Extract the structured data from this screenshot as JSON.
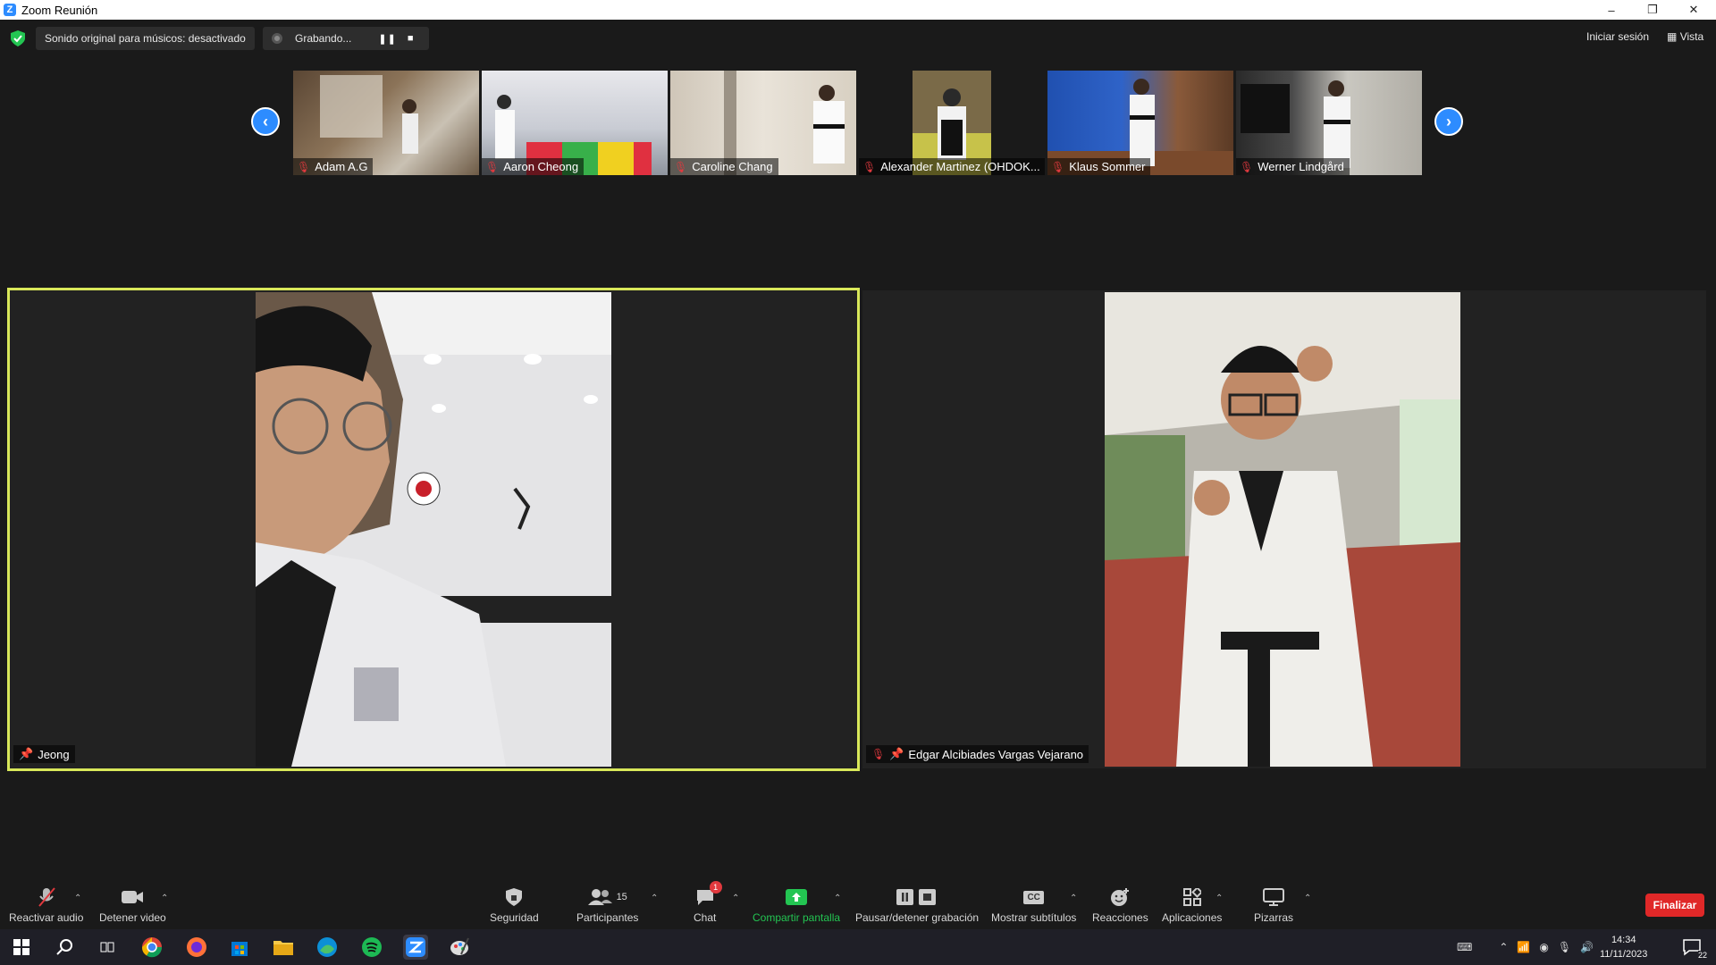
{
  "window": {
    "title": "Zoom Reunión",
    "logo_letter": "Z",
    "controls": {
      "minimize": "–",
      "restore": "❐",
      "close": "✕"
    }
  },
  "topbar": {
    "audio_status": "Sonido original para músicos: desactivado",
    "recording_label": "Grabando...",
    "pause_symbol": "❚❚",
    "stop_symbol": "■",
    "sign_in": "Iniciar sesión",
    "view": "Vista",
    "view_icon": "▦"
  },
  "gallery_strip": {
    "prev_symbol": "‹",
    "next_symbol": "›",
    "thumbnails": [
      {
        "name": "Adam A.G"
      },
      {
        "name": "Aaron Cheong"
      },
      {
        "name": "Caroline Chang"
      },
      {
        "name": "Alexander Martinez (OHDOK..."
      },
      {
        "name": "Klaus Sommer"
      },
      {
        "name": "Werner Lindgård"
      }
    ]
  },
  "main_videos": [
    {
      "name": "Jeong",
      "active_speaker": true
    },
    {
      "name": "Edgar Alcibiades Vargas Vejarano",
      "active_speaker": false
    }
  ],
  "toolbar": {
    "unmute": "Reactivar audio",
    "stop_video": "Detener video",
    "security": "Seguridad",
    "participants": "Participantes",
    "participants_count": "15",
    "chat": "Chat",
    "chat_badge": "1",
    "share": "Compartir pantalla",
    "record": "Pausar/detener grabación",
    "captions": "Mostrar subtítulos",
    "captions_icon": "CC",
    "reactions": "Reacciones",
    "apps": "Aplicaciones",
    "whiteboards": "Pizarras",
    "end": "Finalizar"
  },
  "taskbar": {
    "time": "14:34",
    "date": "11/11/2023",
    "notifications": "22"
  },
  "colors": {
    "accent_blue": "#2d8cff",
    "speaker_border": "#d9e85a",
    "share_green": "#23c552",
    "end_red": "#e02828"
  }
}
